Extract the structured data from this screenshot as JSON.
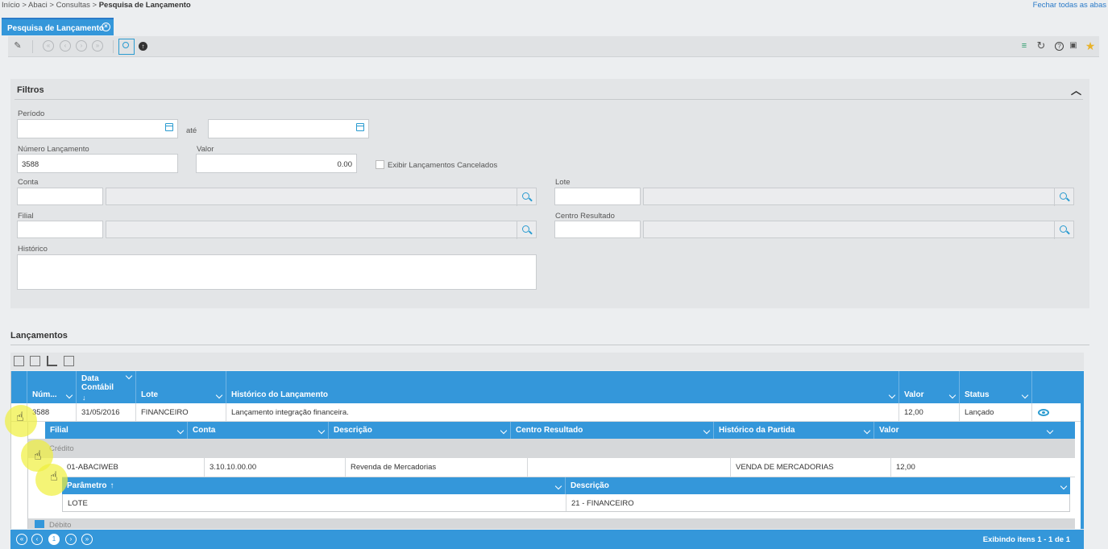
{
  "breadcrumb": {
    "items": [
      "Início",
      "Abaci",
      "Consultas"
    ],
    "current": "Pesquisa de Lançamento",
    "sep": " > "
  },
  "close_all": "Fechar todas as abas",
  "tab": {
    "label": "Pesquisa de Lançamento",
    "close": "⊗"
  },
  "filters": {
    "title": "Filtros",
    "periodo": {
      "label": "Período",
      "from": "",
      "to": "",
      "between": "até"
    },
    "numero": {
      "label": "Número Lançamento",
      "value": "3588"
    },
    "valor": {
      "label": "Valor",
      "value": "0.00"
    },
    "cancelados": {
      "label": "Exibir Lançamentos Cancelados",
      "checked": false
    },
    "conta": {
      "label": "Conta",
      "code": "",
      "desc": ""
    },
    "lote": {
      "label": "Lote",
      "code": "",
      "desc": ""
    },
    "filial": {
      "label": "Filial",
      "code": "",
      "desc": ""
    },
    "centro": {
      "label": "Centro Resultado",
      "code": "",
      "desc": ""
    },
    "historico": {
      "label": "Histórico",
      "value": ""
    }
  },
  "lancamentos": {
    "title": "Lançamentos",
    "columns": {
      "num": "Núm...",
      "data": "Data Contábil",
      "lote": "Lote",
      "hist": "Histórico do Lançamento",
      "valor": "Valor",
      "status": "Status"
    },
    "row": {
      "num": "3588",
      "data": "31/05/2016",
      "lote": "FINANCEIRO",
      "hist": "Lançamento integração financeira.",
      "valor": "12,00",
      "status": "Lançado"
    },
    "detail_columns": {
      "filial": "Filial",
      "conta": "Conta",
      "descricao": "Descrição",
      "centro": "Centro Resultado",
      "hist": "Histórico da Partida",
      "valor": "Valor"
    },
    "credito_group": "Crédito",
    "detail_row": {
      "filial": "01-ABACIWEB",
      "conta": "3.10.10.00.00",
      "descricao": "Revenda de Mercadorias",
      "centro": "",
      "hist": "VENDA DE MERCADORIAS",
      "valor": "12,00"
    },
    "param_columns": {
      "parametro": "Parâmetro",
      "descricao": "Descrição"
    },
    "param_row": {
      "parametro": "LOTE",
      "descricao": "21 - FINANCEIRO"
    },
    "debito_group": "Débito"
  },
  "pager": {
    "page": "1",
    "info": "Exibindo itens 1 - 1 de 1"
  },
  "colors": {
    "accent": "#3497da",
    "link": "#2a7ac8"
  }
}
